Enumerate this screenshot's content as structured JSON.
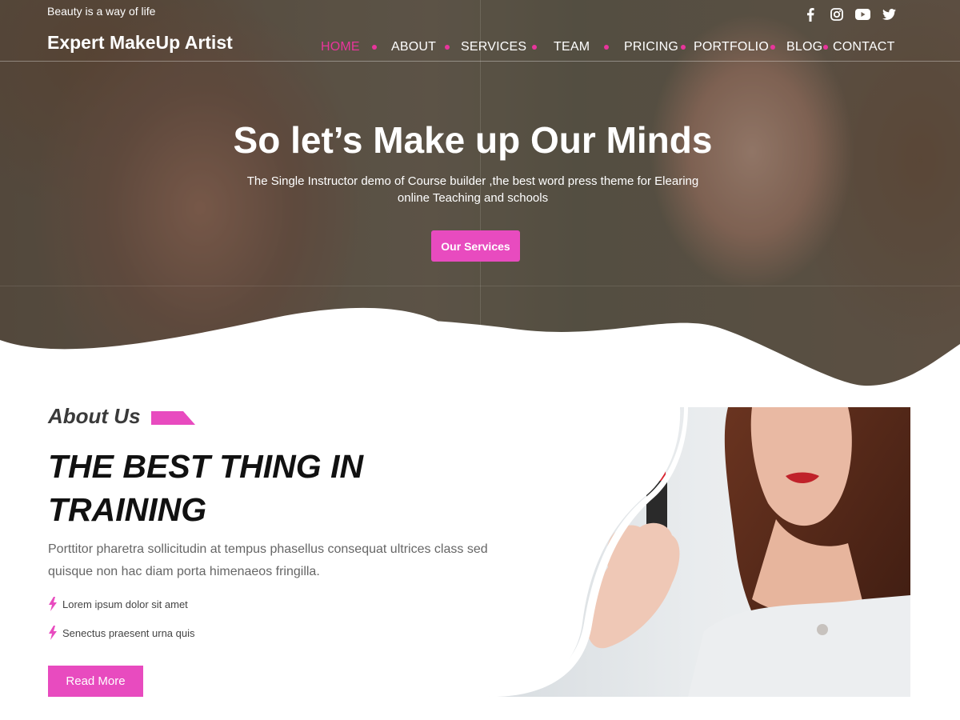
{
  "header": {
    "tagline": "Beauty is a way of life",
    "site_title": "Expert MakeUp Artist",
    "social_icons": [
      "facebook-icon",
      "instagram-icon",
      "youtube-icon",
      "twitter-icon"
    ],
    "nav": [
      "HOME",
      "ABOUT",
      "SERVICES",
      "TEAM",
      "PRICING",
      "PORTFOLIO",
      "BLOG",
      "CONTACT"
    ],
    "active_nav": "HOME"
  },
  "hero": {
    "title": "So let’s Make up Our Minds",
    "subtitle": "The Single Instructor demo of Course builder ,the best word press theme for Elearing online Teaching and schools",
    "button": "Our Services"
  },
  "about": {
    "label": "About Us",
    "heading": "THE BEST THING IN TRAINING",
    "text": "Porttitor pharetra sollicitudin at tempus phasellus consequat ultrices class sed, quisque non hac  diam porta himenaeos fringilla.",
    "features": [
      "Lorem ipsum dolor sit amet",
      "Senectus praesent urna quis"
    ],
    "button": "Read More"
  },
  "colors": {
    "accent": "#e84bbf",
    "nav_active": "#e8359c",
    "heading": "#111111",
    "body_text": "#666666"
  }
}
